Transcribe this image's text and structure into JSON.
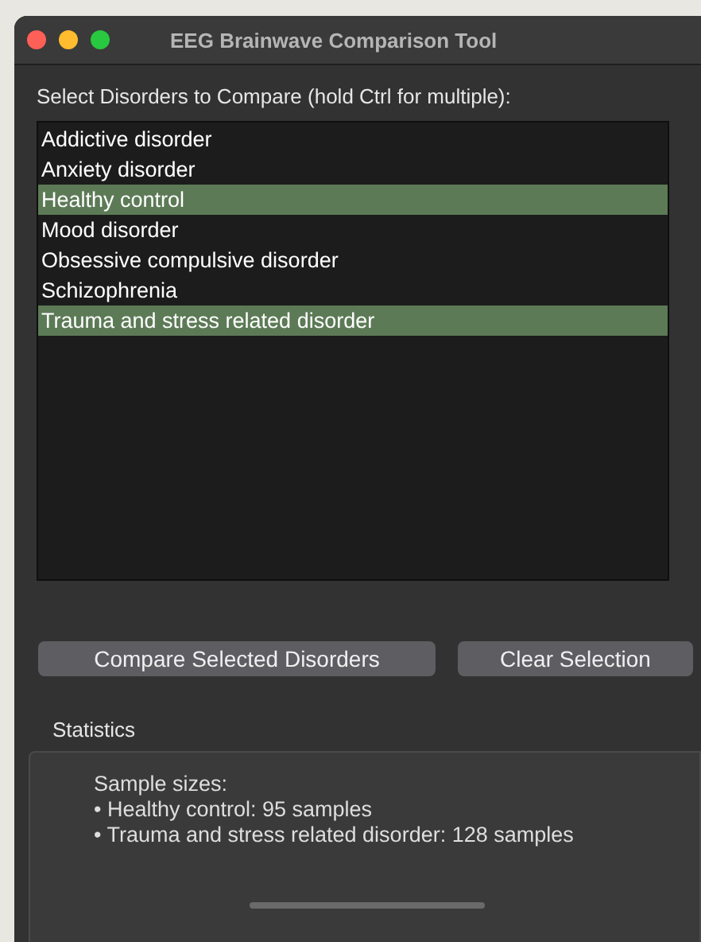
{
  "window": {
    "title": "EEG Brainwave Comparison Tool"
  },
  "list_label": "Select Disorders to Compare (hold Ctrl for multiple):",
  "disorders": [
    {
      "label": "Addictive disorder",
      "selected": false
    },
    {
      "label": "Anxiety disorder",
      "selected": false
    },
    {
      "label": "Healthy control",
      "selected": true
    },
    {
      "label": "Mood disorder",
      "selected": false
    },
    {
      "label": "Obsessive compulsive disorder",
      "selected": false
    },
    {
      "label": "Schizophrenia",
      "selected": false
    },
    {
      "label": "Trauma and stress related disorder",
      "selected": true
    }
  ],
  "buttons": [
    "Compare Selected Disorders",
    "Clear Selection"
  ],
  "statistics": {
    "title": "Statistics",
    "lines": [
      "Sample sizes:",
      "• Healthy control: 95 samples",
      "• Trauma and stress related disorder: 128 samples"
    ]
  }
}
